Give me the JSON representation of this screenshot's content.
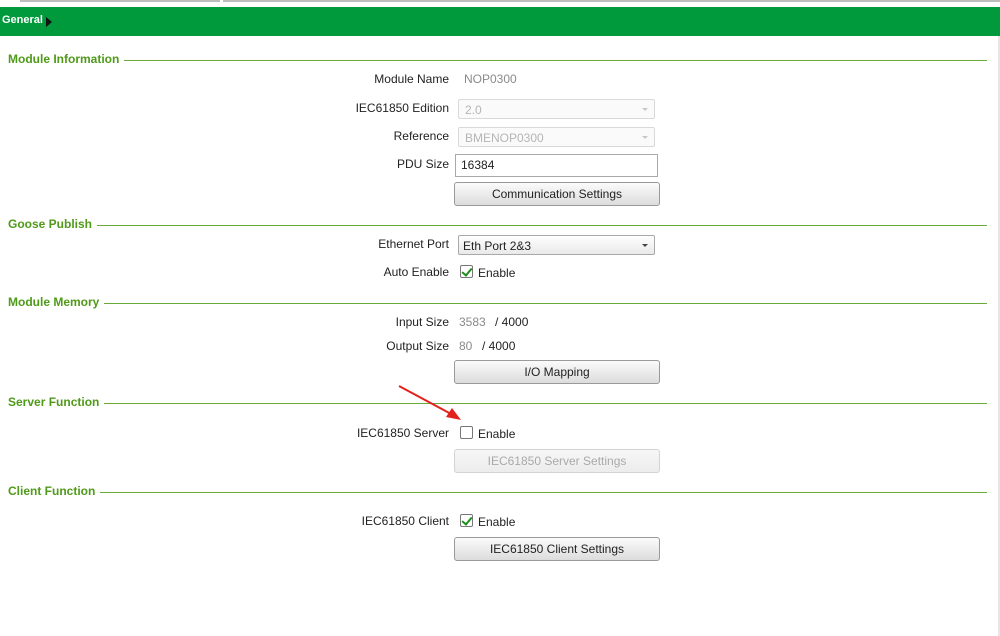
{
  "header": {
    "title": "General"
  },
  "sections": {
    "module_information": {
      "title": "Module Information",
      "module_name_label": "Module Name",
      "module_name_value": "NOP0300",
      "edition_label": "IEC61850 Edition",
      "edition_value": "2.0",
      "reference_label": "Reference",
      "reference_value": "BMENOP0300",
      "pdu_label": "PDU Size",
      "pdu_value": "16384",
      "comm_button": "Communication Settings"
    },
    "goose_publish": {
      "title": "Goose Publish",
      "ethernet_label": "Ethernet Port",
      "ethernet_value": "Eth Port 2&3",
      "auto_label": "Auto Enable",
      "auto_checkbox_label": "Enable",
      "auto_checked": true
    },
    "module_memory": {
      "title": "Module Memory",
      "input_label": "Input Size",
      "input_value": "3583",
      "input_max": "/ 4000",
      "output_label": "Output Size",
      "output_value": "80",
      "output_max": "/ 4000",
      "io_button": "I/O Mapping"
    },
    "server_function": {
      "title": "Server Function",
      "server_label": "IEC61850 Server",
      "server_checkbox_label": "Enable",
      "server_checked": false,
      "server_button": "IEC61850 Server Settings"
    },
    "client_function": {
      "title": "Client Function",
      "client_label": "IEC61850 Client",
      "client_checkbox_label": "Enable",
      "client_checked": true,
      "client_button": "IEC61850 Client Settings"
    }
  },
  "colors": {
    "header_bg": "#009a3d",
    "section_title": "#4f9a19",
    "annotation_arrow": "#e3211c"
  }
}
